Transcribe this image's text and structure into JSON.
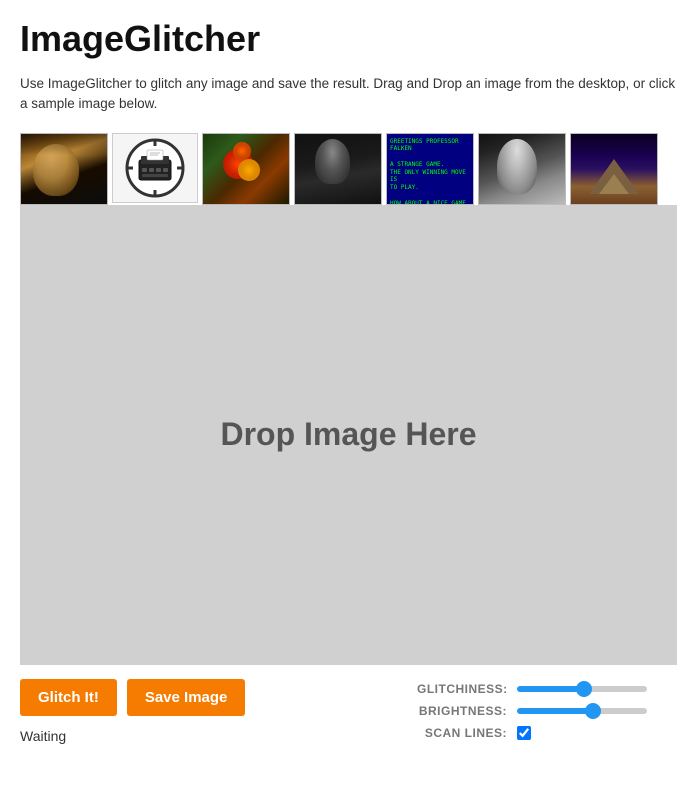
{
  "app": {
    "title": "ImageGlitcher",
    "description": "Use ImageGlitcher to glitch any image and save the result. Drag and Drop an image from the desktop, or click a sample image below."
  },
  "sample_images": [
    {
      "id": "girl-pearl-earring",
      "alt": "Girl with Pearl Earring",
      "color_hint": "portrait_classic"
    },
    {
      "id": "typewriter-logo",
      "alt": "Typewriter Logo",
      "color_hint": "logo_white"
    },
    {
      "id": "flowers",
      "alt": "Flowers",
      "color_hint": "flowers_colorful"
    },
    {
      "id": "fashion-dark",
      "alt": "Fashion Dark",
      "color_hint": "portrait_dark"
    },
    {
      "id": "wargames-text",
      "alt": "Wargames Text",
      "color_hint": "blue_screen_text"
    },
    {
      "id": "fashion-white",
      "alt": "Fashion White",
      "color_hint": "portrait_white_bg"
    },
    {
      "id": "paramount",
      "alt": "Paramount Mountain",
      "color_hint": "dark_mountain"
    }
  ],
  "drop_zone": {
    "text": "Drop Image Here"
  },
  "buttons": {
    "glitch_label": "Glitch It!",
    "save_label": "Save Image"
  },
  "status": {
    "text": "Waiting"
  },
  "controls": {
    "glitchiness_label": "GLITCHINESS:",
    "brightness_label": "BRIGHTNESS:",
    "scan_lines_label": "SCAN LINES:",
    "glitchiness_value": 52,
    "brightness_value": 60,
    "scan_lines_checked": true
  }
}
